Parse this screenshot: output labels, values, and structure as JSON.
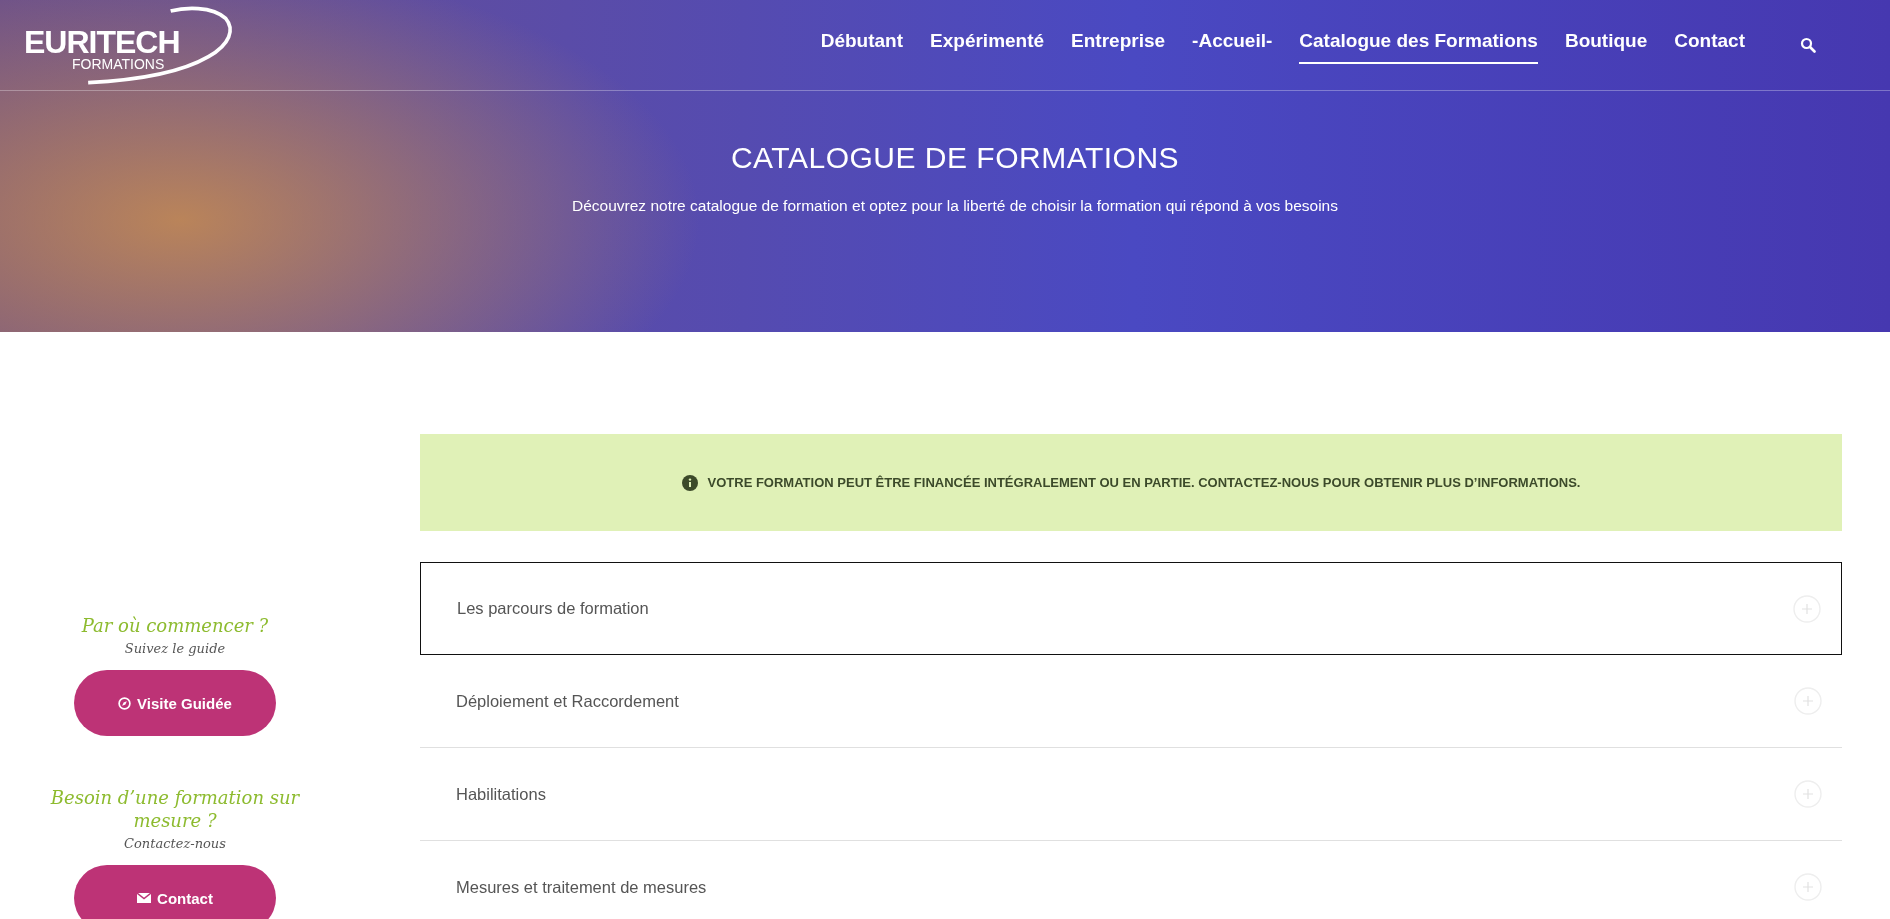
{
  "header": {
    "logo": {
      "name": "EURITECH",
      "tagline": "FORMATIONS"
    },
    "nav": [
      {
        "label": "Débutant",
        "selected": false
      },
      {
        "label": "Expérimenté",
        "selected": false
      },
      {
        "label": "Entreprise",
        "selected": false
      },
      {
        "label": "-Accueil-",
        "selected": false
      },
      {
        "label": "Catalogue des Formations",
        "selected": true
      },
      {
        "label": "Boutique",
        "selected": false
      },
      {
        "label": "Contact",
        "selected": false
      }
    ]
  },
  "banner": {
    "title": "CATALOGUE DE FORMATIONS",
    "subtitle": "Découvrez notre catalogue de formation et optez pour la liberté de choisir la formation qui répond à vos besoins"
  },
  "sidebar": [
    {
      "title": "Par où commencer ?",
      "subtitle": "Suivez le guide",
      "button": {
        "label": "Visite Guidée",
        "kind": "compass"
      }
    },
    {
      "title": "Besoin d’une formation sur mesure ?",
      "subtitle": "Contactez-nous",
      "button": {
        "label": "Contact",
        "kind": "envelope"
      }
    }
  ],
  "notice": "VOTRE FORMATION PEUT ÊTRE FINANCÉE INTÉGRALEMENT OU EN PARTIE. CONTACTEZ-NOUS POUR OBTENIR PLUS D’INFORMATIONS.",
  "accordion": [
    {
      "label": "Les parcours de formation",
      "selected": true
    },
    {
      "label": "Déploiement et Raccordement",
      "selected": false
    },
    {
      "label": "Habilitations",
      "selected": false
    },
    {
      "label": "Mesures et traitement de mesures",
      "selected": false
    }
  ]
}
